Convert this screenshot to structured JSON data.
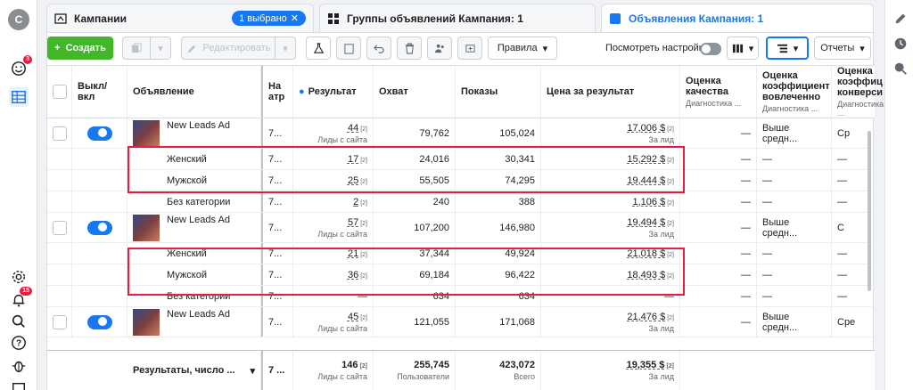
{
  "rail": {
    "avatar_letter": "C",
    "notif_badge": "3",
    "bell_badge": "15",
    "icons": [
      "smiley-icon",
      "table-icon",
      "gear-icon",
      "bell-icon",
      "search-icon",
      "help-icon",
      "bug-icon"
    ]
  },
  "tabs": [
    {
      "label": "Кампании",
      "chip": "1 выбрано"
    },
    {
      "label": "Группы объявлений Кампания: 1"
    },
    {
      "label": "Объявления Кампания: 1"
    }
  ],
  "toolbar": {
    "create": "Создать",
    "edit": "Редактировать",
    "rules": "Правила",
    "view_settings": "Посмотреть настройки",
    "reports": "Отчеты"
  },
  "columns": {
    "onoff": "Выкл/вкл",
    "ad": "Объявление",
    "delivery": "На атр",
    "result": "Результат",
    "reach": "Охват",
    "impressions": "Показы",
    "cost": "Цена за результат",
    "quality": "Оценка качества",
    "quality_sub": "Диагностика ...",
    "engagement": "Оценка коэффициент вовлеченно",
    "engagement_sub": "Диагностика ...",
    "conversion": "Оценка коэффиц конверси",
    "conversion_sub": "Диагностика ..."
  },
  "rows": [
    {
      "type": "ad",
      "name": "New Leads Ad",
      "delivery": "7...",
      "result": "44",
      "result_sub": "Лиды с сайта",
      "reach": "79,762",
      "impressions": "105,024",
      "cost": "17,006 $",
      "cost_sub": "За лид",
      "quality": "—",
      "engagement": "Выше средн...",
      "conversion": "Ср"
    },
    {
      "type": "sub",
      "name": "Женский",
      "delivery": "7...",
      "result": "17",
      "reach": "24,016",
      "impressions": "30,341",
      "cost": "15,292 $",
      "quality": "—",
      "engagement": "—",
      "conversion": "—"
    },
    {
      "type": "sub",
      "name": "Мужской",
      "delivery": "7...",
      "result": "25",
      "reach": "55,505",
      "impressions": "74,295",
      "cost": "19,444 $",
      "quality": "—",
      "engagement": "—",
      "conversion": "—"
    },
    {
      "type": "sub",
      "name": "Без категории",
      "delivery": "7...",
      "result": "2",
      "reach": "240",
      "impressions": "388",
      "cost": "1,106 $",
      "quality": "—",
      "engagement": "—",
      "conversion": "—"
    },
    {
      "type": "ad",
      "name": "New Leads Ad",
      "delivery": "7...",
      "result": "57",
      "result_sub": "Лиды с сайта",
      "reach": "107,200",
      "impressions": "146,980",
      "cost": "19,494 $",
      "cost_sub": "За лид",
      "quality": "—",
      "engagement": "Выше средн...",
      "conversion": "С"
    },
    {
      "type": "sub",
      "name": "Женский",
      "delivery": "7...",
      "result": "21",
      "reach": "37,344",
      "impressions": "49,924",
      "cost": "21,018 $",
      "quality": "—",
      "engagement": "—",
      "conversion": "—"
    },
    {
      "type": "sub",
      "name": "Мужской",
      "delivery": "7...",
      "result": "36",
      "reach": "69,184",
      "impressions": "96,422",
      "cost": "18,493 $",
      "quality": "—",
      "engagement": "—",
      "conversion": "—"
    },
    {
      "type": "sub",
      "name": "Без категории",
      "delivery": "7...",
      "result": "—",
      "reach": "634",
      "impressions": "634",
      "cost": "—",
      "quality": "—",
      "engagement": "—",
      "conversion": "—"
    },
    {
      "type": "ad",
      "name": "New Leads Ad",
      "delivery": "7...",
      "result": "45",
      "result_sub": "Лиды с сайта",
      "reach": "121,055",
      "impressions": "171,068",
      "cost": "21,476 $",
      "cost_sub": "За лид",
      "quality": "—",
      "engagement": "Выше средн...",
      "conversion": "Сре"
    }
  ],
  "footer": {
    "label": "Результаты, число ...",
    "delivery": "7 ...",
    "result": "146",
    "result_sub": "Лиды с сайта",
    "reach": "255,745",
    "reach_sub": "Пользователи",
    "impressions": "423,072",
    "impressions_sub": "Всего",
    "cost": "19,355 $",
    "cost_sub": "За лид"
  },
  "footnote": "[2]",
  "colors": {
    "accent": "#1877f2",
    "create": "#42b72a",
    "highlight": "#e41e3f"
  }
}
